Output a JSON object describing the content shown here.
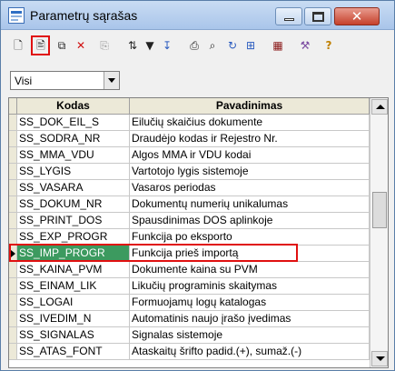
{
  "window": {
    "title": "Parametrų sąrašas",
    "controls": {
      "minimize": "—",
      "maximize": "□",
      "close": "✕"
    }
  },
  "toolbar": {
    "buttons": [
      {
        "icon": "new-record-icon",
        "glyph": "🗋"
      },
      {
        "icon": "edit-record-icon",
        "glyph": "🖹",
        "highlighted": true
      },
      {
        "icon": "copy-record-icon",
        "glyph": "⧉"
      },
      {
        "icon": "delete-icon",
        "glyph": "✕"
      },
      {
        "icon": "paste-icon",
        "glyph": "⎘"
      },
      {
        "icon": "sort-icon",
        "glyph": "⇅"
      },
      {
        "icon": "filter-icon",
        "glyph": "▼"
      },
      {
        "icon": "sort-az-icon",
        "glyph": "↧"
      },
      {
        "icon": "print-icon",
        "glyph": "⎙"
      },
      {
        "icon": "find-icon",
        "glyph": "⌕"
      },
      {
        "icon": "refresh-icon",
        "glyph": "↻"
      },
      {
        "icon": "tree-icon",
        "glyph": "⊞"
      },
      {
        "icon": "grid-icon",
        "glyph": "▦"
      },
      {
        "icon": "tools-icon",
        "glyph": "⚒"
      },
      {
        "icon": "help-icon",
        "glyph": "?"
      }
    ],
    "accent": "#e01010"
  },
  "filter": {
    "selected": "Visi"
  },
  "table": {
    "columns": [
      "Kodas",
      "Pavadinimas"
    ],
    "rows": [
      [
        "SS_DOK_EIL_S",
        "Eilučių skaičius dokumente"
      ],
      [
        "SS_SODRA_NR",
        "Draudėjo kodas ir Rejestro Nr."
      ],
      [
        "SS_MMA_VDU",
        "Algos MMA ir VDU kodai"
      ],
      [
        "SS_LYGIS",
        "Vartotojo lygis sistemoje"
      ],
      [
        "SS_VASARA",
        "Vasaros periodas"
      ],
      [
        "SS_DOKUM_NR",
        "Dokumentų numerių unikalumas"
      ],
      [
        "SS_PRINT_DOS",
        "Spausdinimas DOS aplinkoje"
      ],
      [
        "SS_EXP_PROGR",
        "Funkcija po eksporto"
      ],
      [
        "SS_IMP_PROGR",
        "Funkcija prieš importą"
      ],
      [
        "SS_KAINA_PVM",
        "Dokumente kaina su PVM"
      ],
      [
        "SS_EINAM_LIK",
        "Likučių programinis skaitymas"
      ],
      [
        "SS_LOGAI",
        "Formuojamų logų katalogas"
      ],
      [
        "SS_IVEDIM_N",
        "Automatinis naujo įrašo įvedimas"
      ],
      [
        "SS_SIGNALAS",
        "Signalas sistemoje"
      ],
      [
        "SS_ATAS_FONT",
        "Ataskaitų šrifto padid.(+), sumaž.(-)"
      ]
    ],
    "selected_index": 8,
    "selected_color": "#3c9a5f"
  }
}
